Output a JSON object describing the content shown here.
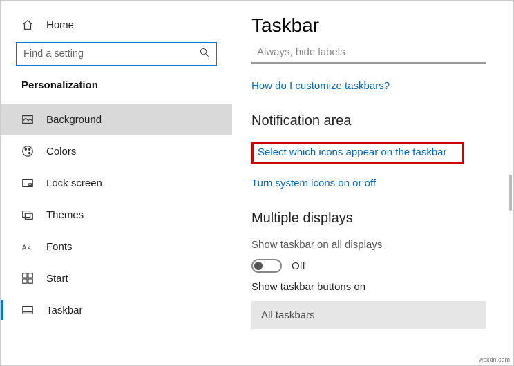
{
  "sidebar": {
    "home": "Home",
    "search_placeholder": "Find a setting",
    "category": "Personalization",
    "items": [
      {
        "label": "Background"
      },
      {
        "label": "Colors"
      },
      {
        "label": "Lock screen"
      },
      {
        "label": "Themes"
      },
      {
        "label": "Fonts"
      },
      {
        "label": "Start"
      },
      {
        "label": "Taskbar"
      }
    ]
  },
  "main": {
    "title": "Taskbar",
    "combine_value": "Always, hide labels",
    "help_link": "How do I customize taskbars?",
    "section_notification": "Notification area",
    "link_icons": "Select which icons appear on the taskbar",
    "link_system": "Turn system icons on or off",
    "section_multi": "Multiple displays",
    "show_all_label": "Show taskbar on all displays",
    "toggle_value": "Off",
    "show_buttons_label": "Show taskbar buttons on",
    "show_buttons_value": "All taskbars"
  },
  "footer": "wsxdn.com"
}
